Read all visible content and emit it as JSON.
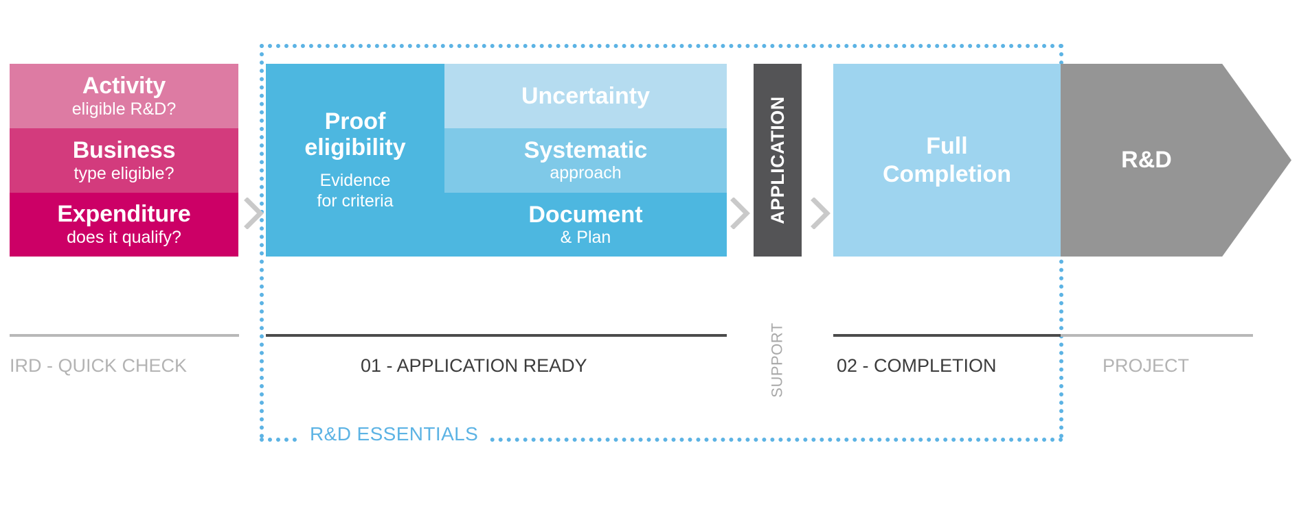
{
  "diagram": {
    "title_hidden": "",
    "colors": {
      "pink_light": "#dd7ba3",
      "pink_mid": "#d33b7d",
      "pink_strong": "#cc0066",
      "blue_mid": "#4db7e0",
      "blue_light": "#b5dcf0",
      "blue_soft": "#7fc9e8",
      "blue_pale": "#9ed4ef",
      "dark_gray": "#545456",
      "gray": "#959595",
      "dotted_blue": "#5cb3e4",
      "caption_light": "#b3b3b3",
      "caption_dark": "#3b3b3b"
    }
  },
  "quick_check": {
    "caption": "IRD - QUICK CHECK",
    "cells": [
      {
        "title": "Activity",
        "subtitle": "eligible R&D?",
        "color": "#dd7ba3"
      },
      {
        "title": "Business",
        "subtitle": "type eligible?",
        "color": "#d33b7d"
      },
      {
        "title": "Expenditure",
        "subtitle": "does it qualify?",
        "color": "#cc0066"
      }
    ]
  },
  "application_ready": {
    "caption": "01 - APPLICATION READY",
    "proof": {
      "title_line1": "Proof",
      "title_line2": "eligibility",
      "sub_line1": "Evidence",
      "sub_line2": "for criteria",
      "color": "#4db7e0"
    },
    "criteria": [
      {
        "title": "Uncertainty",
        "subtitle": "",
        "color": "#b5dcf0"
      },
      {
        "title": "Systematic",
        "subtitle": "approach",
        "color": "#7fc9e8"
      },
      {
        "title": "Document",
        "subtitle": "& Plan",
        "color": "#4db7e0"
      }
    ]
  },
  "application_support": {
    "column_label": "APPLICATION",
    "support_label": "SUPPORT",
    "color": "#545456"
  },
  "completion": {
    "caption": "02 - COMPLETION",
    "title_line1": "Full",
    "title_line2": "Completion",
    "color": "#9ed4ef"
  },
  "project": {
    "caption": "PROJECT",
    "label": "R&D",
    "color": "#959595"
  },
  "essentials": {
    "label": "R&D ESSENTIALS",
    "color": "#5cb3e4"
  },
  "icons": {
    "chevron_1": "chevron-right-icon",
    "chevron_2": "chevron-right-icon",
    "chevron_3": "chevron-right-icon"
  }
}
